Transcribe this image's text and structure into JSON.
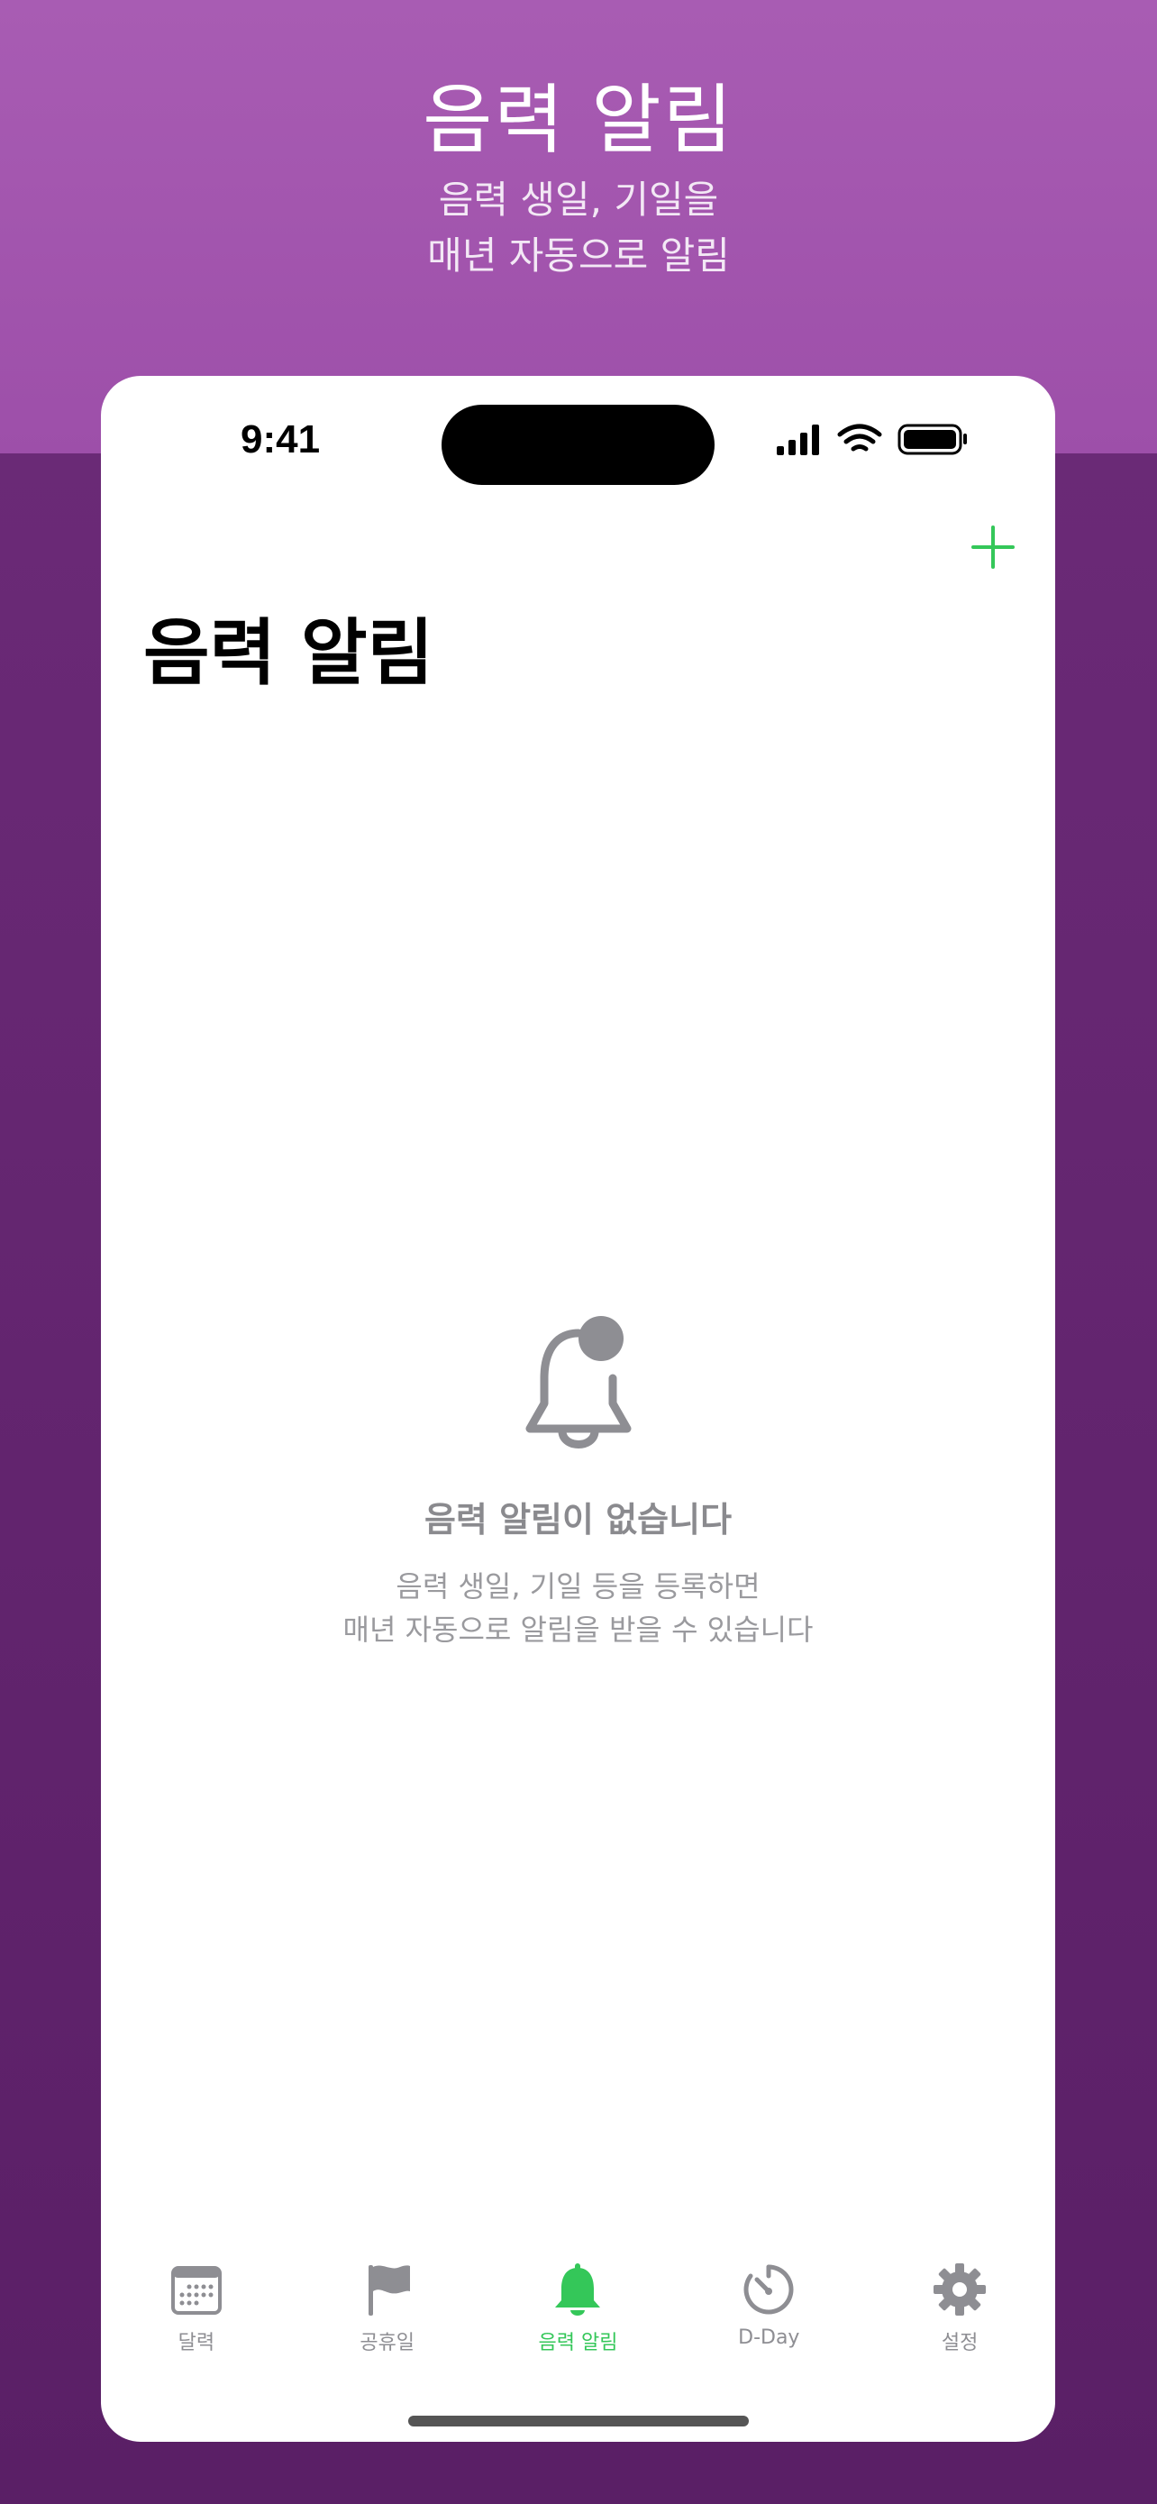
{
  "promo": {
    "title": "음력 알림",
    "subtitle_line1": "음력 생일, 기일을",
    "subtitle_line2": "매년 자동으로 알림"
  },
  "status_bar": {
    "time": "9:41"
  },
  "header": {
    "title": "음력 알림",
    "add_icon": "plus-icon"
  },
  "empty_state": {
    "icon": "bell-badge-icon",
    "title": "음력 알림이 없습니다",
    "desc_line1": "음력 생일, 기일 등을 등록하면",
    "desc_line2": "매년 자동으로 알림을 받을 수 있습니다"
  },
  "tabs": [
    {
      "label": "달력",
      "icon": "calendar-icon",
      "active": false
    },
    {
      "label": "공휴일",
      "icon": "flag-icon",
      "active": false
    },
    {
      "label": "음력 알림",
      "icon": "bell-icon",
      "active": true
    },
    {
      "label": "D-Day",
      "icon": "timer-icon",
      "active": false
    },
    {
      "label": "설정",
      "icon": "gear-icon",
      "active": false
    }
  ],
  "colors": {
    "accent": "#34c759",
    "inactive": "#8e8e93",
    "promo_background": "#a85cb3",
    "page_background": "#5a1f66"
  }
}
